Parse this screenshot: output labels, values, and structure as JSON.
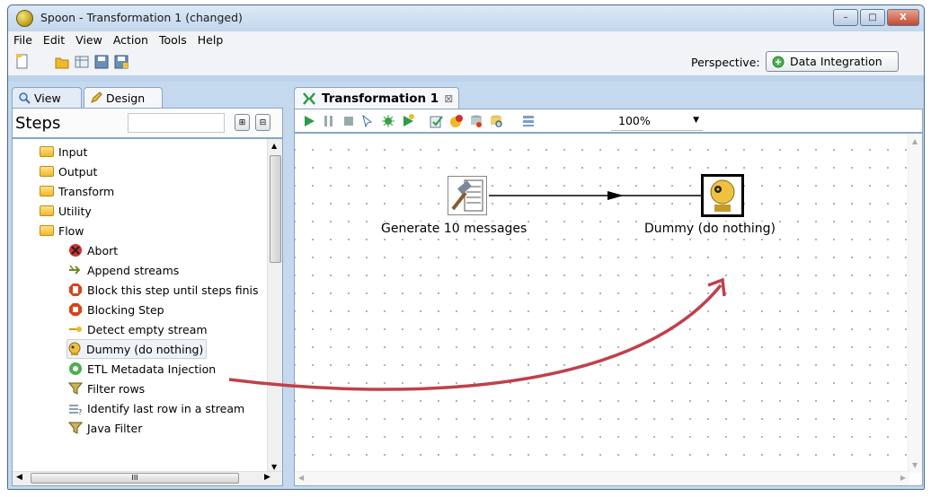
{
  "window": {
    "title": "Spoon - Transformation 1 (changed)",
    "minimize": "–",
    "maximize": "□",
    "close": "X"
  },
  "menu": [
    "File",
    "Edit",
    "View",
    "Action",
    "Tools",
    "Help"
  ],
  "perspective": {
    "label": "Perspective:",
    "value": "Data Integration"
  },
  "left": {
    "tabs": {
      "view": "View",
      "design": "Design"
    },
    "steps_title": "Steps",
    "search_value": "",
    "tree": [
      {
        "label": "Input",
        "icon": "folder-icon",
        "indent": 0
      },
      {
        "label": "Output",
        "icon": "folder-icon",
        "indent": 0
      },
      {
        "label": "Transform",
        "icon": "folder-icon",
        "indent": 0
      },
      {
        "label": "Utility",
        "icon": "folder-icon",
        "indent": 0
      },
      {
        "label": "Flow",
        "icon": "folder-icon",
        "indent": 0
      },
      {
        "label": "Abort",
        "icon": "abort-icon",
        "indent": 1
      },
      {
        "label": "Append streams",
        "icon": "append-icon",
        "indent": 1
      },
      {
        "label": "Block this step until steps finis",
        "icon": "block-icon",
        "indent": 1
      },
      {
        "label": "Blocking Step",
        "icon": "blocking-icon",
        "indent": 1
      },
      {
        "label": "Detect empty stream",
        "icon": "detect-icon",
        "indent": 1
      },
      {
        "label": "Dummy (do nothing)",
        "icon": "dummy-icon",
        "indent": 1,
        "selected": true
      },
      {
        "label": "ETL Metadata Injection",
        "icon": "etl-icon",
        "indent": 1
      },
      {
        "label": "Filter rows",
        "icon": "filter-icon",
        "indent": 1
      },
      {
        "label": "Identify last row in a stream",
        "icon": "identify-icon",
        "indent": 1
      },
      {
        "label": "Java Filter",
        "icon": "java-filter-icon",
        "indent": 1
      }
    ],
    "hscroll_glyph": "III"
  },
  "doc": {
    "tab_label": "Transformation 1",
    "tab_close": "⊠",
    "zoom": "100%",
    "nodes": [
      {
        "label": "Generate 10 messages",
        "icon": "generate-rows-icon"
      },
      {
        "label": "Dummy (do nothing)",
        "icon": "dummy-icon"
      }
    ]
  },
  "colors": {
    "arrow": "#c0404a",
    "hop": "#000000"
  }
}
